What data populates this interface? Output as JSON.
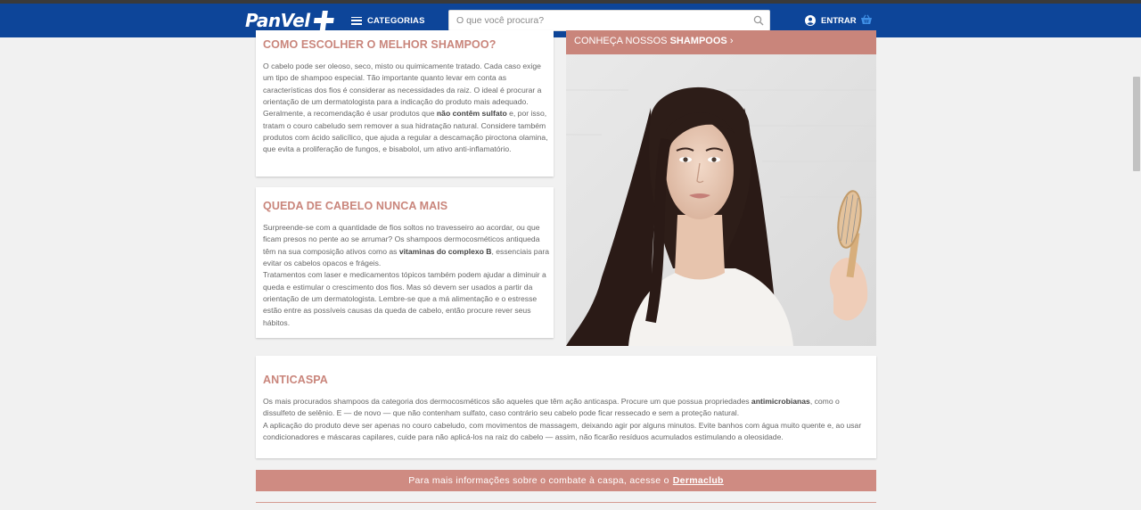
{
  "header": {
    "logo_text": "PanVel",
    "categories_label": "CATEGORIAS",
    "search_placeholder": "O que você procura?",
    "login_label": "ENTRAR",
    "brand_color": "#0d4599"
  },
  "card_shampoo": {
    "title": "COMO ESCOLHER O MELHOR SHAMPOO?",
    "text_before_bold": "O cabelo pode ser oleoso, seco, misto ou quimicamente tratado. Cada caso exige um tipo de shampoo especial. Tão importante quanto levar em conta as características dos fios é considerar as necessidades da raiz. O ideal é procurar a orientação de um dermatologista para a indicação do produto mais adequado. Geralmente, a recomendação é usar produtos que ",
    "text_bold": "não contêm sulfato",
    "text_after_bold": " e, por isso, tratam o couro cabeludo sem remover a sua hidratação natural. Considere também produtos com ácido salicílico, que ajuda a regular a descamação piroctona olamina, que evita a proliferação de fungos, e bisabolol, um ativo anti-inflamatório."
  },
  "card_queda": {
    "title": "QUEDA DE CABELO NUNCA MAIS",
    "text_before_bold": "Surpreende-se com a quantidade de fios soltos no travesseiro ao acordar, ou que ficam presos no pente ao se arrumar? Os shampoos dermocosméticos antiqueda têm na sua composição ativos como as ",
    "text_bold": "vitaminas do complexo B",
    "text_after_bold": ", essenciais para evitar os cabelos opacos e frágeis.",
    "paragraph_2": "Tratamentos com laser e medicamentos tópicos também podem ajudar a diminuir a queda e estimular o crescimento dos fios. Mas só devem ser usados a partir da orientação de um dermatologista. Lembre-se que a má alimentação e o estresse estão entre as possíveis causas da queda de cabelo, então procure rever seus hábitos."
  },
  "promo": {
    "banner_prefix": "CONHEÇA NOSSOS ",
    "banner_bold": "SHAMPOOS",
    "banner_arrow": "›",
    "accent_color": "#c9857b"
  },
  "card_anticaspa": {
    "title": "ANTICASPA",
    "text_before_bold": "Os mais procurados shampoos da categoria dos dermocosméticos são aqueles que têm ação anticaspa. Procure um que possua propriedades ",
    "text_bold": "antimicrobianas",
    "text_after_bold": ", como o dissulfeto de selênio. E — de novo — que não contenham sulfato, caso contrário seu cabelo pode ficar ressecado e sem a proteção natural.",
    "paragraph_2": "A aplicação do produto deve ser apenas no couro cabeludo, com movimentos de massagem, deixando agir por alguns minutos. Evite banhos com água muito quente e, ao usar condicionadores e máscaras capilares, cuide para não aplicá-los na raiz do cabelo — assim, não ficarão resíduos acumulados estimulando a oleosidade."
  },
  "cta": {
    "text": "Para mais informações sobre o combate à caspa, acesse o",
    "link": "Dermaclub"
  }
}
